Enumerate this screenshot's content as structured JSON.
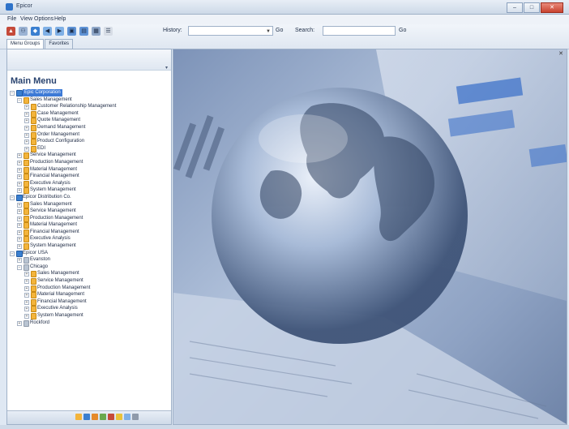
{
  "window": {
    "title": "Epicor"
  },
  "menubar": [
    "File",
    "View",
    "Options",
    "Help"
  ],
  "toolbar": {
    "history_label": "History:",
    "go_label": "Go",
    "search_label": "Search:",
    "go2_label": "Go"
  },
  "tabs": [
    "Menu Groups",
    "Favorites"
  ],
  "left": {
    "title": "Main Menu",
    "tree": [
      {
        "label": "Epic Corporation",
        "level": 0,
        "icon": "company",
        "expanded": true,
        "selected": true
      },
      {
        "label": "Sales Management",
        "level": 1,
        "icon": "folder",
        "expanded": true
      },
      {
        "label": "Customer Relationship Management",
        "level": 2,
        "icon": "folder"
      },
      {
        "label": "Case Management",
        "level": 2,
        "icon": "folder"
      },
      {
        "label": "Quote Management",
        "level": 2,
        "icon": "folder"
      },
      {
        "label": "Demand Management",
        "level": 2,
        "icon": "folder"
      },
      {
        "label": "Order Management",
        "level": 2,
        "icon": "folder"
      },
      {
        "label": "Product Configuration",
        "level": 2,
        "icon": "folder"
      },
      {
        "label": "EDI",
        "level": 2,
        "icon": "folder"
      },
      {
        "label": "Service Management",
        "level": 1,
        "icon": "folder"
      },
      {
        "label": "Production Management",
        "level": 1,
        "icon": "folder"
      },
      {
        "label": "Material Management",
        "level": 1,
        "icon": "folder"
      },
      {
        "label": "Financial Management",
        "level": 1,
        "icon": "folder"
      },
      {
        "label": "Executive Analysis",
        "level": 1,
        "icon": "folder"
      },
      {
        "label": "System Management",
        "level": 1,
        "icon": "folder"
      },
      {
        "label": "Epicor Distribution Co.",
        "level": 0,
        "icon": "company",
        "expanded": true
      },
      {
        "label": "Sales Management",
        "level": 1,
        "icon": "folder"
      },
      {
        "label": "Service Management",
        "level": 1,
        "icon": "folder"
      },
      {
        "label": "Production Management",
        "level": 1,
        "icon": "folder"
      },
      {
        "label": "Material Management",
        "level": 1,
        "icon": "folder"
      },
      {
        "label": "Financial Management",
        "level": 1,
        "icon": "folder"
      },
      {
        "label": "Executive Analysis",
        "level": 1,
        "icon": "folder"
      },
      {
        "label": "System Management",
        "level": 1,
        "icon": "folder"
      },
      {
        "label": "Epicor USA",
        "level": 0,
        "icon": "company",
        "expanded": true
      },
      {
        "label": "Evanston",
        "level": 1,
        "icon": "site"
      },
      {
        "label": "Chicago",
        "level": 1,
        "icon": "site",
        "expanded": true
      },
      {
        "label": "Sales Management",
        "level": 2,
        "icon": "folder"
      },
      {
        "label": "Service Management",
        "level": 2,
        "icon": "folder"
      },
      {
        "label": "Production Management",
        "level": 2,
        "icon": "folder"
      },
      {
        "label": "Material Management",
        "level": 2,
        "icon": "folder"
      },
      {
        "label": "Financial Management",
        "level": 2,
        "icon": "folder"
      },
      {
        "label": "Executive Analysis",
        "level": 2,
        "icon": "folder"
      },
      {
        "label": "System Management",
        "level": 2,
        "icon": "folder"
      },
      {
        "label": "Rockford",
        "level": 1,
        "icon": "site"
      }
    ]
  },
  "colors": {
    "accent": "#3d7ad6",
    "folder": "#f3b43c",
    "company": "#3a7fd0"
  }
}
